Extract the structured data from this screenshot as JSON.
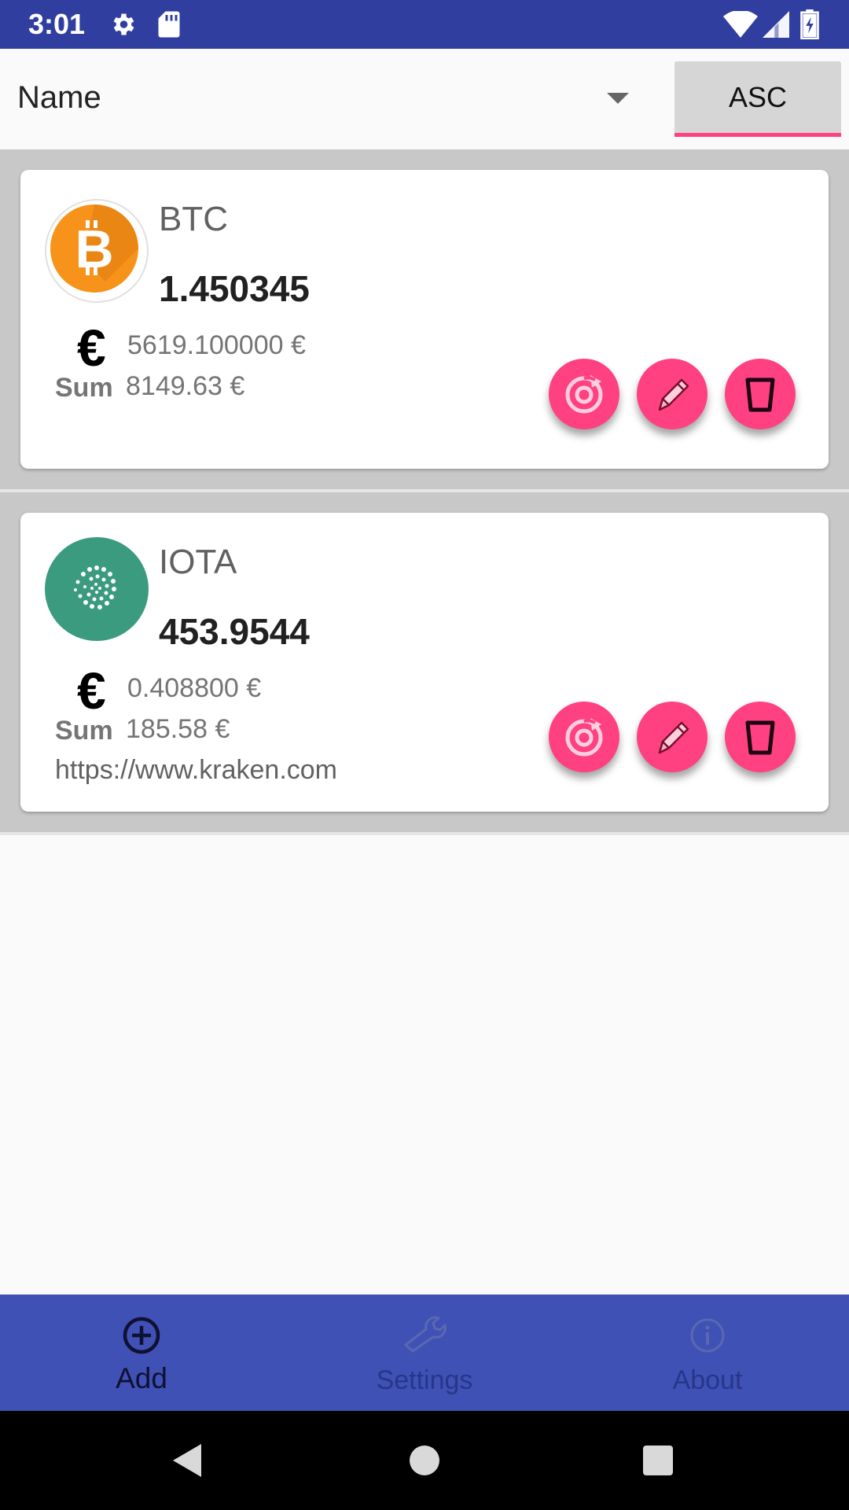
{
  "status_bar": {
    "time": "3:01",
    "icons": [
      "gear-icon",
      "sd-card-icon",
      "wifi-icon",
      "signal-icon",
      "battery-icon"
    ]
  },
  "sort_bar": {
    "selected_sort": "Name",
    "order_button": "ASC"
  },
  "coins": [
    {
      "symbol": "BTC",
      "amount": "1.450345",
      "currency_icon": "€",
      "price": "5619.100000 €",
      "sum_label": "Sum",
      "sum": "8149.63 €",
      "url": ""
    },
    {
      "symbol": "IOTA",
      "amount": "453.9544",
      "currency_icon": "€",
      "price": "0.408800 €",
      "sum_label": "Sum",
      "sum": "185.58 €",
      "url": "https://www.kraken.com"
    }
  ],
  "bottom_nav": {
    "items": [
      {
        "label": "Add",
        "icon": "add-circle-icon"
      },
      {
        "label": "Settings",
        "icon": "wrench-icon"
      },
      {
        "label": "About",
        "icon": "info-icon"
      }
    ]
  },
  "colors": {
    "status_bar": "#303f9f",
    "primary": "#3f51b5",
    "accent": "#ff4081",
    "btc_orange": "#f7931a",
    "iota_green": "#3b9b7f"
  }
}
